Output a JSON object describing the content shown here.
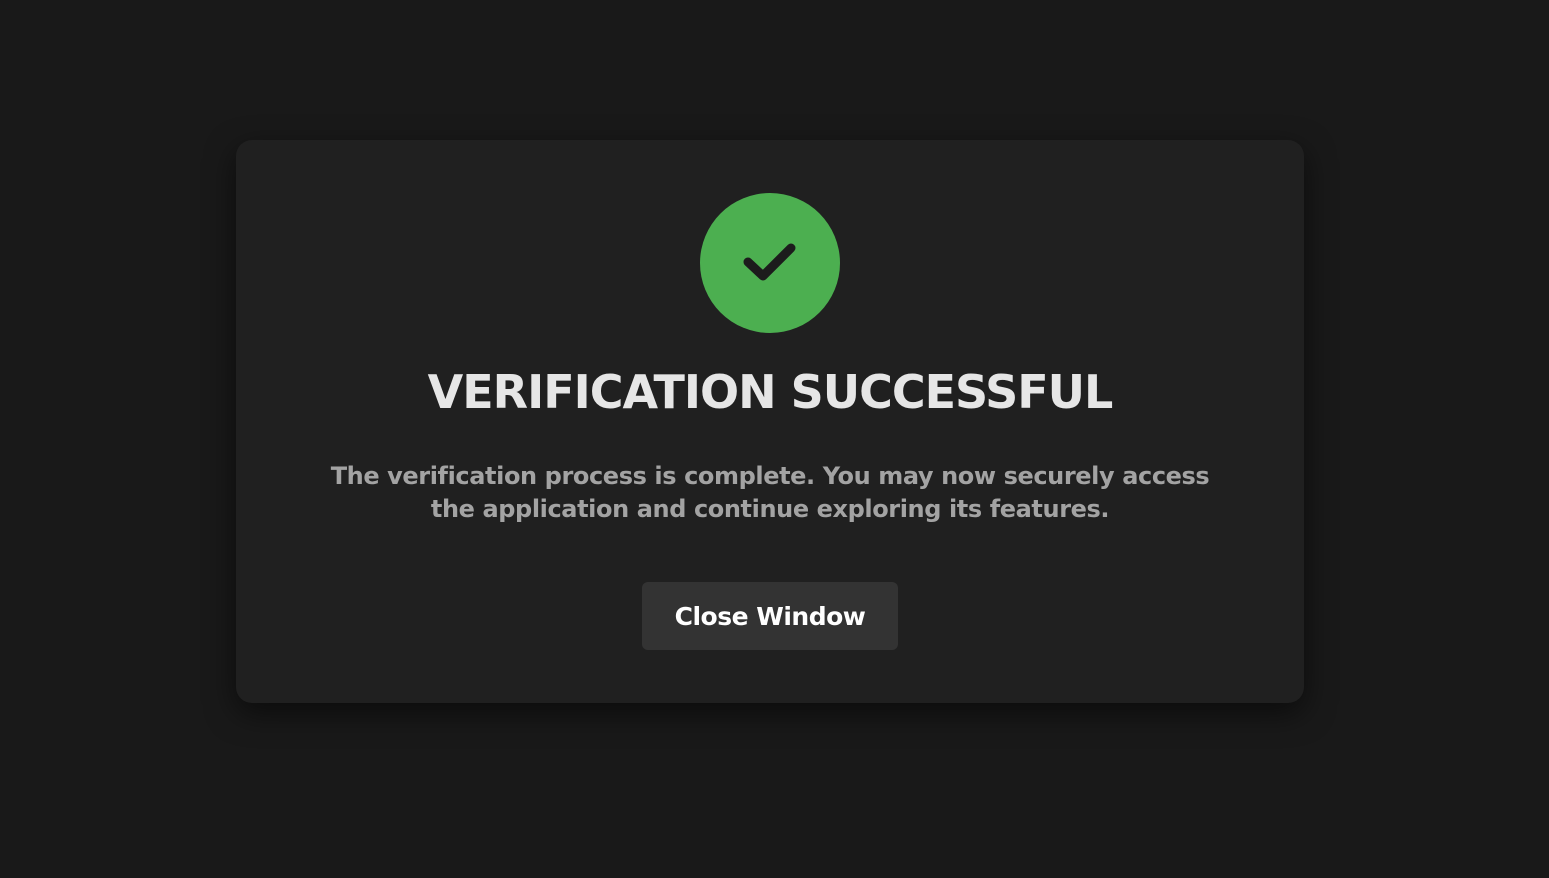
{
  "dialog": {
    "icon": "checkmark-icon",
    "icon_color": "#4caf50",
    "title": "VERIFICATION SUCCESSFUL",
    "message": "The verification process is complete. You may now securely access the application and continue exploring its features.",
    "close_button_label": "Close Window"
  },
  "colors": {
    "background": "#191919",
    "card": "#202020",
    "button": "#333333",
    "title_text": "#e6e6e6",
    "message_text": "#a3a3a3"
  }
}
